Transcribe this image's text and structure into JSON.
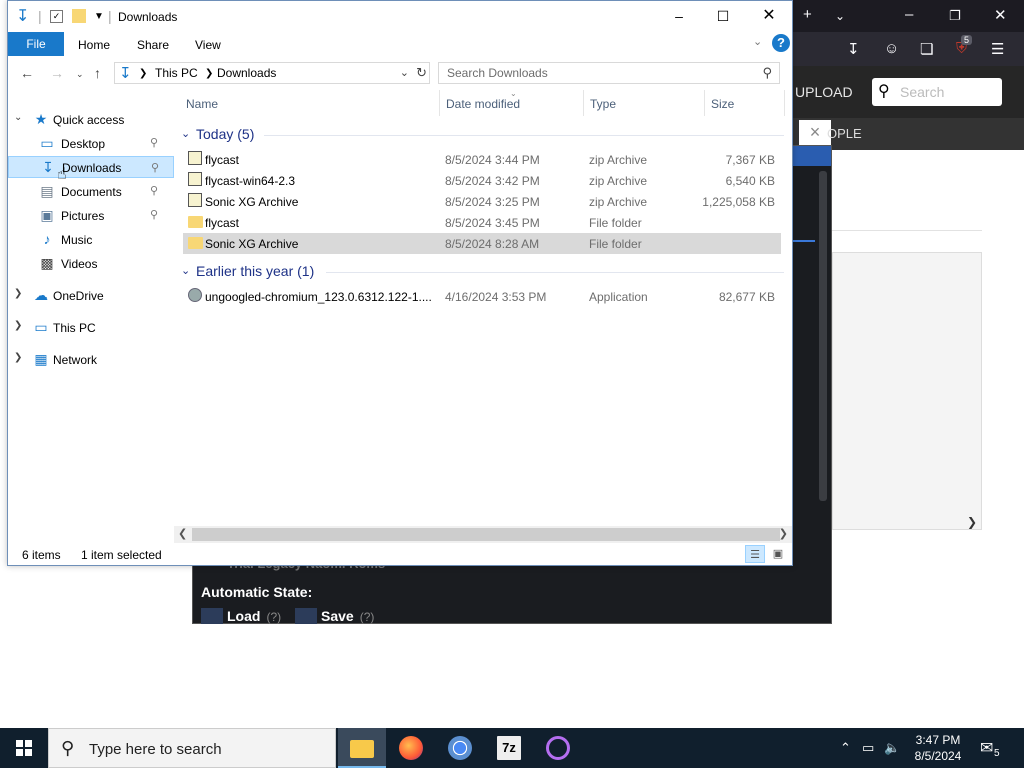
{
  "explorer": {
    "title": "Downloads",
    "ribbon_tabs": [
      "File",
      "Home",
      "Share",
      "View"
    ],
    "help": "?",
    "address": {
      "crumbs": [
        "This PC",
        "Downloads"
      ]
    },
    "search_placeholder": "Search Downloads",
    "nav_pane": {
      "quick_access": "Quick access",
      "items": [
        {
          "label": "Desktop",
          "pinned": true
        },
        {
          "label": "Downloads",
          "pinned": true,
          "selected": true
        },
        {
          "label": "Documents",
          "pinned": true
        },
        {
          "label": "Pictures",
          "pinned": true
        },
        {
          "label": "Music",
          "pinned": false
        },
        {
          "label": "Videos",
          "pinned": false
        }
      ],
      "onedrive": "OneDrive",
      "this_pc": "This PC",
      "network": "Network"
    },
    "columns": [
      "Name",
      "Date modified",
      "Type",
      "Size"
    ],
    "groups": [
      {
        "label": "Today (5)",
        "files": [
          {
            "name": "flycast",
            "date": "8/5/2024 3:44 PM",
            "type": "zip Archive",
            "size": "7,367 KB",
            "icon": "zip-icon"
          },
          {
            "name": "flycast-win64-2.3",
            "date": "8/5/2024 3:42 PM",
            "type": "zip Archive",
            "size": "6,540 KB",
            "icon": "zip-icon"
          },
          {
            "name": "Sonic XG Archive",
            "date": "8/5/2024 3:25 PM",
            "type": "zip Archive",
            "size": "1,225,058 KB",
            "icon": "zip-icon"
          },
          {
            "name": "flycast",
            "date": "8/5/2024 3:45 PM",
            "type": "File folder",
            "size": "",
            "icon": "folder-icon"
          },
          {
            "name": "Sonic XG Archive",
            "date": "8/5/2024 8:28 AM",
            "type": "File folder",
            "size": "",
            "icon": "folder-icon",
            "selected": true
          }
        ]
      },
      {
        "label": "Earlier this year (1)",
        "files": [
          {
            "name": "ungoogled-chromium_123.0.6312.122-1....",
            "date": "4/16/2024 3:53 PM",
            "type": "Application",
            "size": "82,677 KB",
            "icon": "application-icon"
          }
        ]
      }
    ],
    "status": {
      "item_count": "6 items",
      "selected": "1 item selected"
    }
  },
  "browser": {
    "badge": "5",
    "upload": "UPLOAD",
    "search_placeholder": "Search",
    "people": "OPLE"
  },
  "emulator": {
    "ghost_title": "Trial Legacy Naomi Roms",
    "automatic_state": "Automatic State:",
    "buttons": [
      {
        "label": "Load",
        "hint": "(?)"
      },
      {
        "label": "Save",
        "hint": "(?)"
      }
    ]
  },
  "taskbar": {
    "search_text": "Type here to search",
    "time": "3:47 PM",
    "date": "8/5/2024",
    "notification_count": "5"
  },
  "colors": {
    "accent": "#1979ca",
    "taskbar": "#101f2d",
    "selection": "#cce8ff",
    "group_header": "#1e3287"
  }
}
